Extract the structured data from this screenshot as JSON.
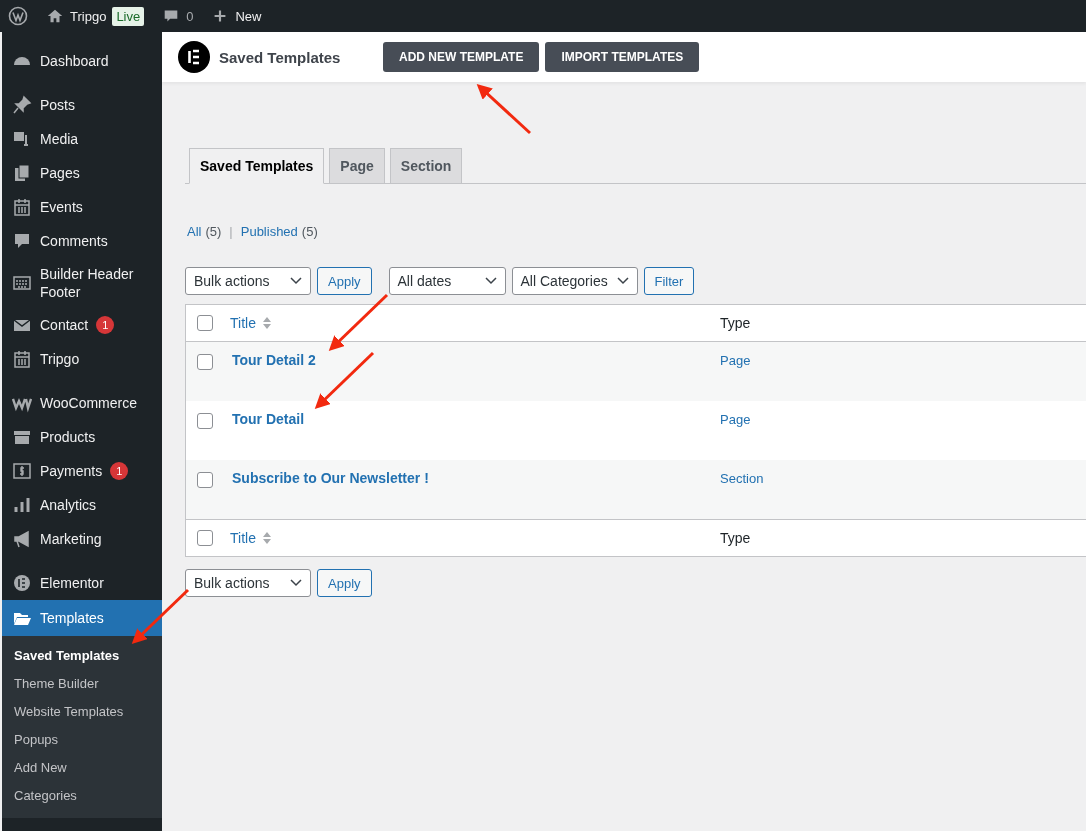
{
  "admin_bar": {
    "site": "Tripgo",
    "status_badge": "Live",
    "comments_count": "0",
    "new_label": "New"
  },
  "sidebar": {
    "groups": [
      {
        "items": [
          {
            "label": "Dashboard",
            "selected": false
          }
        ]
      },
      {
        "items": [
          {
            "label": "Posts",
            "selected": false
          },
          {
            "label": "Media",
            "selected": false
          },
          {
            "label": "Pages",
            "selected": false
          },
          {
            "label": "Events",
            "selected": false
          },
          {
            "label": "Comments",
            "selected": false
          },
          {
            "label": "Builder Header Footer",
            "selected": false
          },
          {
            "label": "Contact",
            "badge": "1",
            "selected": false
          },
          {
            "label": "Tripgo",
            "selected": false
          }
        ]
      },
      {
        "items": [
          {
            "label": "WooCommerce",
            "selected": false
          },
          {
            "label": "Products",
            "selected": false
          },
          {
            "label": "Payments",
            "badge": "1",
            "selected": false
          },
          {
            "label": "Analytics",
            "selected": false
          },
          {
            "label": "Marketing",
            "selected": false
          }
        ]
      },
      {
        "items": [
          {
            "label": "Elementor",
            "selected": false
          },
          {
            "label": "Templates",
            "selected": true,
            "children": [
              {
                "label": "Saved Templates",
                "selected": true
              },
              {
                "label": "Theme Builder",
                "selected": false
              },
              {
                "label": "Website Templates",
                "selected": false
              },
              {
                "label": "Popups",
                "selected": false
              },
              {
                "label": "Add New",
                "selected": false
              },
              {
                "label": "Categories",
                "selected": false
              }
            ]
          }
        ]
      }
    ]
  },
  "header": {
    "title": "Saved Templates",
    "buttons": [
      "ADD NEW TEMPLATE",
      "IMPORT TEMPLATES"
    ]
  },
  "tabs": [
    {
      "label": "Saved Templates",
      "selected": true
    },
    {
      "label": "Page",
      "selected": false
    },
    {
      "label": "Section",
      "selected": false
    }
  ],
  "views": {
    "items": [
      {
        "label": "All",
        "count": "(5)"
      },
      {
        "label": "Published",
        "count": "(5)"
      }
    ],
    "separator": "|"
  },
  "filters": {
    "bulk_action": "Bulk actions",
    "apply": "Apply",
    "dates": "All dates",
    "categories": "All Categories",
    "filter": "Filter"
  },
  "table": {
    "columns": [
      "Title",
      "Type"
    ],
    "select_all_checked": false,
    "footer_columns": [
      "Title",
      "Type"
    ],
    "footer_select_all_checked": false,
    "rows": [
      {
        "title": "Tour Detail 2",
        "type": "Page",
        "checked": false
      },
      {
        "title": "Tour Detail",
        "type": "Page",
        "checked": false
      },
      {
        "title": "Subscribe to Our Newsletter !",
        "type": "Section",
        "checked": false
      }
    ]
  },
  "bottom_actions": {
    "bulk_action": "Bulk actions",
    "apply": "Apply"
  }
}
